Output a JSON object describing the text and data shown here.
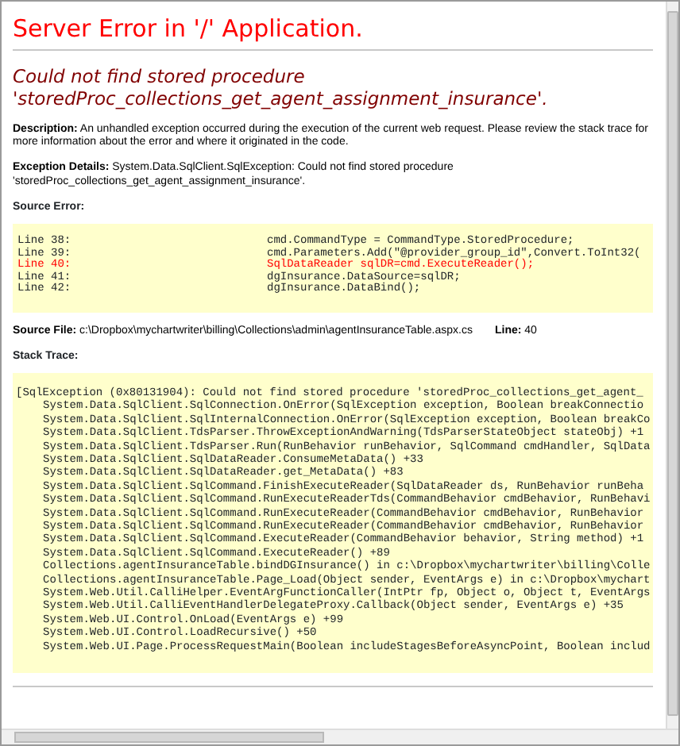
{
  "title": "Server Error in '/' Application.",
  "error_heading": "Could not find stored procedure 'storedProc_collections_get_agent_assignment_insurance'.",
  "description": "**Description:** An unhandled exception occurred during the execution of the current web request. Please review the stack trace for more information about the error and where it originated in the code.",
  "exception_details": "**Exception Details:** System.Data.SqlClient.SqlException: Could not find stored procedure 'storedProc_collections_get_agent_assignment_insurance'.",
  "source_error": {
    "label": "Source Error:",
    "lines": [
      {
        "label": "Line 38:",
        "code": "cmd.CommandType = CommandType.StoredProcedure;",
        "highlighted": false
      },
      {
        "label": "Line 39:",
        "code": "cmd.Parameters.Add(\"@provider_group_id\",Convert.ToInt32(",
        "highlighted": false
      },
      {
        "label": "Line 40:",
        "code": "SqlDataReader sqlDR=cmd.ExecuteReader();",
        "highlighted": true
      },
      {
        "label": "Line 41:",
        "code": "dgInsurance.DataSource=sqlDR;",
        "highlighted": false
      },
      {
        "label": "Line 42:",
        "code": "dgInsurance.DataBind();",
        "highlighted": false
      }
    ]
  },
  "source_file": "**Source File:** c:\\Dropbox\\mychartwriter\\billing\\Collections\\admin\\agentInsuranceTable.aspx.cs",
  "line": "**Line:** 40",
  "stack_trace": {
    "label": "Stack Trace:",
    "header": "[SqlException (0x80131904): Could not find stored procedure 'storedProc_collections_get_agent_",
    "frames": [
      "System.Data.SqlClient.SqlConnection.OnError(SqlException exception, Boolean breakConnectio",
      "System.Data.SqlClient.SqlInternalConnection.OnError(SqlException exception, Boolean breakCo",
      "System.Data.SqlClient.TdsParser.ThrowExceptionAndWarning(TdsParserStateObject stateObj) +1",
      "System.Data.SqlClient.TdsParser.Run(RunBehavior runBehavior, SqlCommand cmdHandler, SqlData",
      "System.Data.SqlClient.SqlDataReader.ConsumeMetaData() +33",
      "System.Data.SqlClient.SqlDataReader.get_MetaData() +83",
      "System.Data.SqlClient.SqlCommand.FinishExecuteReader(SqlDataReader ds, RunBehavior runBeha",
      "System.Data.SqlClient.SqlCommand.RunExecuteReaderTds(CommandBehavior cmdBehavior, RunBehavi",
      "System.Data.SqlClient.SqlCommand.RunExecuteReader(CommandBehavior cmdBehavior, RunBehavior",
      "System.Data.SqlClient.SqlCommand.RunExecuteReader(CommandBehavior cmdBehavior, RunBehavior",
      "System.Data.SqlClient.SqlCommand.ExecuteReader(CommandBehavior behavior, String method) +1",
      "System.Data.SqlClient.SqlCommand.ExecuteReader() +89",
      "Collections.agentInsuranceTable.bindDGInsurance() in c:\\Dropbox\\mychartwriter\\billing\\Colle",
      "Collections.agentInsuranceTable.Page_Load(Object sender, EventArgs e) in c:\\Dropbox\\mychart",
      "System.Web.Util.CalliHelper.EventArgFunctionCaller(IntPtr fp, Object o, Object t, EventArgs",
      "System.Web.Util.CalliEventHandlerDelegateProxy.Callback(Object sender, EventArgs e) +35",
      "System.Web.UI.Control.OnLoad(EventArgs e) +99",
      "System.Web.UI.Control.LoadRecursive() +50",
      "System.Web.UI.Page.ProcessRequestMain(Boolean includeStagesBeforeAsyncPoint, Boolean includ"
    ]
  }
}
